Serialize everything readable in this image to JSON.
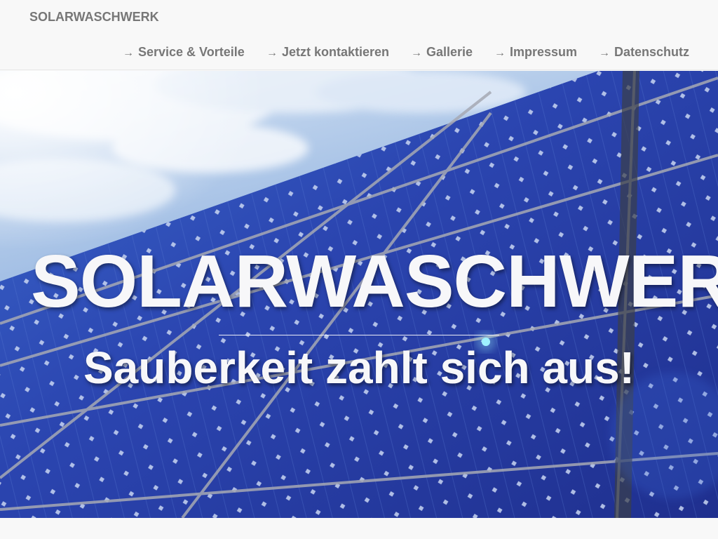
{
  "brand": "SOLARWASCHWERK",
  "nav": [
    {
      "label": "Service & Vorteile",
      "icon": "arrow-right-icon"
    },
    {
      "label": "Jetzt kontaktieren",
      "icon": "arrow-right-icon"
    },
    {
      "label": "Gallerie",
      "icon": "arrow-right-icon"
    },
    {
      "label": "Impressum",
      "icon": "arrow-right-icon"
    },
    {
      "label": "Datenschutz",
      "icon": "arrow-right-icon"
    }
  ],
  "nav_arrow": "→",
  "hero": {
    "title": "SOLARWASCHWERK",
    "subtitle": "Sauberkeit zahlt sich aus!"
  },
  "colors": {
    "nav_text": "#777777",
    "navbar_bg": "#f8f8f8",
    "panel_blue": "#2a3f9e",
    "sky_blue": "#8fb3e0",
    "hero_text": "#f7f7f9"
  }
}
